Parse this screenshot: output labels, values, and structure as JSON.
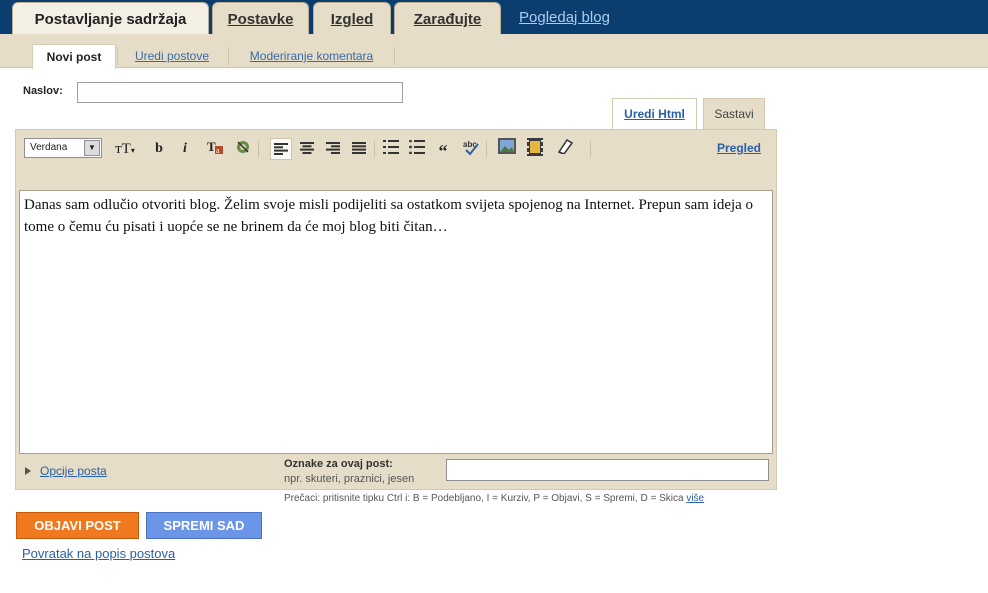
{
  "top_tabs": [
    {
      "label": "Postavljanje sadržaja",
      "active": true
    },
    {
      "label": "Postavke",
      "active": false
    },
    {
      "label": "Izgled",
      "active": false
    },
    {
      "label": "Zarađujte",
      "active": false
    }
  ],
  "view_blog_link": "Pogledaj blog",
  "sub_tabs": [
    {
      "label": "Novi post",
      "active": true
    },
    {
      "label": "Uredi postove",
      "active": false
    },
    {
      "label": "Moderiranje komentara",
      "active": false
    }
  ],
  "title": {
    "label": "Naslov:",
    "value": ""
  },
  "edit_tabs": {
    "html": "Uredi Html",
    "compose": "Sastavi"
  },
  "toolbar": {
    "font": "Verdana",
    "buttons": [
      "font-size-icon",
      "bold-icon",
      "italic-icon",
      "text-color-icon",
      "link-icon",
      "align-left-icon",
      "align-center-icon",
      "align-right-icon",
      "align-justify-icon",
      "numbered-list-icon",
      "bullet-list-icon",
      "blockquote-icon",
      "spellcheck-icon",
      "image-icon",
      "video-icon",
      "eraser-icon"
    ],
    "preview": "Pregled"
  },
  "body_text": "Danas sam odlučio otvoriti blog. Želim svoje misli podijeliti sa ostatkom svijeta spojenog na Internet. Prepun sam ideja o tome o čemu ću pisati i uopće se ne brinem da će moj blog biti čitan…",
  "post_options": "Opcije posta",
  "labels": {
    "title": "Oznake za ovaj post:",
    "hint": "npr. skuteri, praznici, jesen",
    "value": ""
  },
  "shortcuts": {
    "text": "Prečaci: pritisnite tipku Ctrl i: B = Podebljano, I = Kurziv, P = Objavi, S = Spremi, D = Skica",
    "more": "više"
  },
  "buttons": {
    "publish": "OBJAVI POST",
    "save": "SPREMI SAD"
  },
  "back_link": "Povratak na popis postova"
}
